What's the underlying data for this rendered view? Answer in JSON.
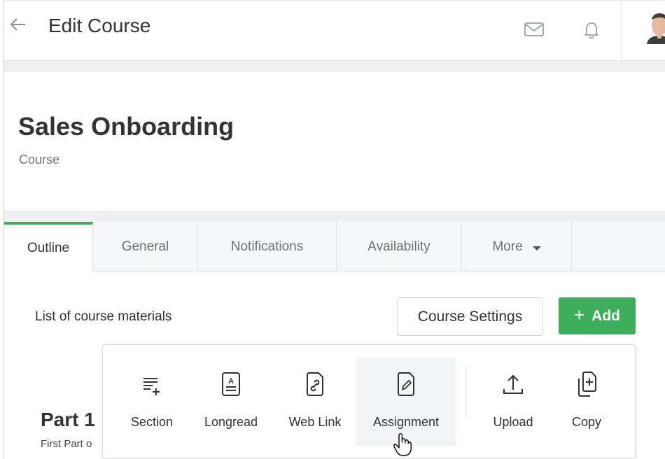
{
  "header": {
    "title": "Edit Course",
    "icons": [
      "back-arrow-icon",
      "mail-icon",
      "bell-icon",
      "avatar"
    ]
  },
  "course": {
    "title": "Sales Onboarding",
    "type": "Course"
  },
  "tabs": [
    {
      "label": "Outline",
      "active": true
    },
    {
      "label": "General",
      "active": false
    },
    {
      "label": "Notifications",
      "active": false
    },
    {
      "label": "Availability",
      "active": false
    },
    {
      "label": "More",
      "active": false
    }
  ],
  "content": {
    "list_label": "List of course materials",
    "settings_button": "Course Settings",
    "add_button": "Add"
  },
  "add_menu": {
    "items": [
      {
        "label": "Section",
        "icon": "section-add-icon"
      },
      {
        "label": "Longread",
        "icon": "longread-icon"
      },
      {
        "label": "Web Link",
        "icon": "web-link-icon"
      },
      {
        "label": "Assignment",
        "icon": "assignment-icon",
        "hovered": true
      },
      {
        "label": "Upload",
        "icon": "upload-icon"
      },
      {
        "label": "Copy",
        "icon": "copy-icon"
      }
    ]
  },
  "part": {
    "title": "Part 1",
    "description": "First Part o"
  },
  "colors": {
    "accent": "#3dae5c",
    "tab_bg": "#f6f7f8",
    "band": "#eef0f1"
  }
}
